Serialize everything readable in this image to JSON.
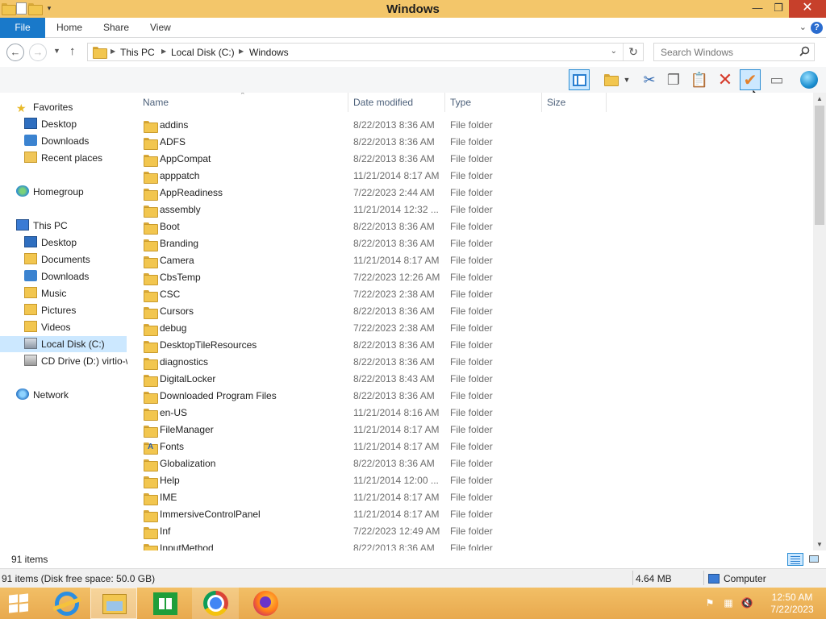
{
  "window": {
    "title": "Windows",
    "controls": {
      "minimize": "—",
      "restore": "❐",
      "close": "✕"
    }
  },
  "ribbon": {
    "tabs": [
      {
        "label": "File",
        "accent": "#1979ca"
      },
      {
        "label": "Home"
      },
      {
        "label": "Share"
      },
      {
        "label": "View"
      }
    ]
  },
  "address": {
    "crumbs": [
      "This PC",
      "Local Disk (C:)",
      "Windows"
    ],
    "search_placeholder": "Search Windows"
  },
  "nav": {
    "favorites": {
      "label": "Favorites",
      "items": [
        "Desktop",
        "Downloads",
        "Recent places"
      ]
    },
    "homegroup": {
      "label": "Homegroup"
    },
    "thispc": {
      "label": "This PC",
      "items": [
        "Desktop",
        "Documents",
        "Downloads",
        "Music",
        "Pictures",
        "Videos",
        "Local Disk (C:)",
        "CD Drive (D:) virtio-w"
      ]
    },
    "network": {
      "label": "Network"
    }
  },
  "columns": {
    "name": "Name",
    "date": "Date modified",
    "type": "Type",
    "size": "Size"
  },
  "files": [
    {
      "name": "addins",
      "date": "8/22/2013 8:36 AM",
      "type": "File folder"
    },
    {
      "name": "ADFS",
      "date": "8/22/2013 8:36 AM",
      "type": "File folder"
    },
    {
      "name": "AppCompat",
      "date": "8/22/2013 8:36 AM",
      "type": "File folder"
    },
    {
      "name": "apppatch",
      "date": "11/21/2014 8:17 AM",
      "type": "File folder"
    },
    {
      "name": "AppReadiness",
      "date": "7/22/2023 2:44 AM",
      "type": "File folder"
    },
    {
      "name": "assembly",
      "date": "11/21/2014 12:32 ...",
      "type": "File folder"
    },
    {
      "name": "Boot",
      "date": "8/22/2013 8:36 AM",
      "type": "File folder"
    },
    {
      "name": "Branding",
      "date": "8/22/2013 8:36 AM",
      "type": "File folder"
    },
    {
      "name": "Camera",
      "date": "11/21/2014 8:17 AM",
      "type": "File folder"
    },
    {
      "name": "CbsTemp",
      "date": "7/22/2023 12:26 AM",
      "type": "File folder"
    },
    {
      "name": "CSC",
      "date": "7/22/2023 2:38 AM",
      "type": "File folder"
    },
    {
      "name": "Cursors",
      "date": "8/22/2013 8:36 AM",
      "type": "File folder"
    },
    {
      "name": "debug",
      "date": "7/22/2023 2:38 AM",
      "type": "File folder"
    },
    {
      "name": "DesktopTileResources",
      "date": "8/22/2013 8:36 AM",
      "type": "File folder"
    },
    {
      "name": "diagnostics",
      "date": "8/22/2013 8:36 AM",
      "type": "File folder"
    },
    {
      "name": "DigitalLocker",
      "date": "8/22/2013 8:43 AM",
      "type": "File folder"
    },
    {
      "name": "Downloaded Program Files",
      "date": "8/22/2013 8:36 AM",
      "type": "File folder"
    },
    {
      "name": "en-US",
      "date": "11/21/2014 8:16 AM",
      "type": "File folder"
    },
    {
      "name": "FileManager",
      "date": "11/21/2014 8:17 AM",
      "type": "File folder"
    },
    {
      "name": "Fonts",
      "date": "11/21/2014 8:17 AM",
      "type": "File folder"
    },
    {
      "name": "Globalization",
      "date": "8/22/2013 8:36 AM",
      "type": "File folder"
    },
    {
      "name": "Help",
      "date": "11/21/2014 12:00 ...",
      "type": "File folder"
    },
    {
      "name": "IME",
      "date": "11/21/2014 8:17 AM",
      "type": "File folder"
    },
    {
      "name": "ImmersiveControlPanel",
      "date": "11/21/2014 8:17 AM",
      "type": "File folder"
    },
    {
      "name": "Inf",
      "date": "7/22/2023 12:49 AM",
      "type": "File folder"
    },
    {
      "name": "InputMethod",
      "date": "8/22/2013 8:36 AM",
      "type": "File folder"
    }
  ],
  "status": {
    "item_count": "91 items"
  },
  "details": {
    "summary": "91 items (Disk free space: 50.0 GB)",
    "size": "4.64 MB",
    "location": "Computer"
  },
  "clock": {
    "time": "12:50 AM",
    "date": "7/22/2023"
  }
}
